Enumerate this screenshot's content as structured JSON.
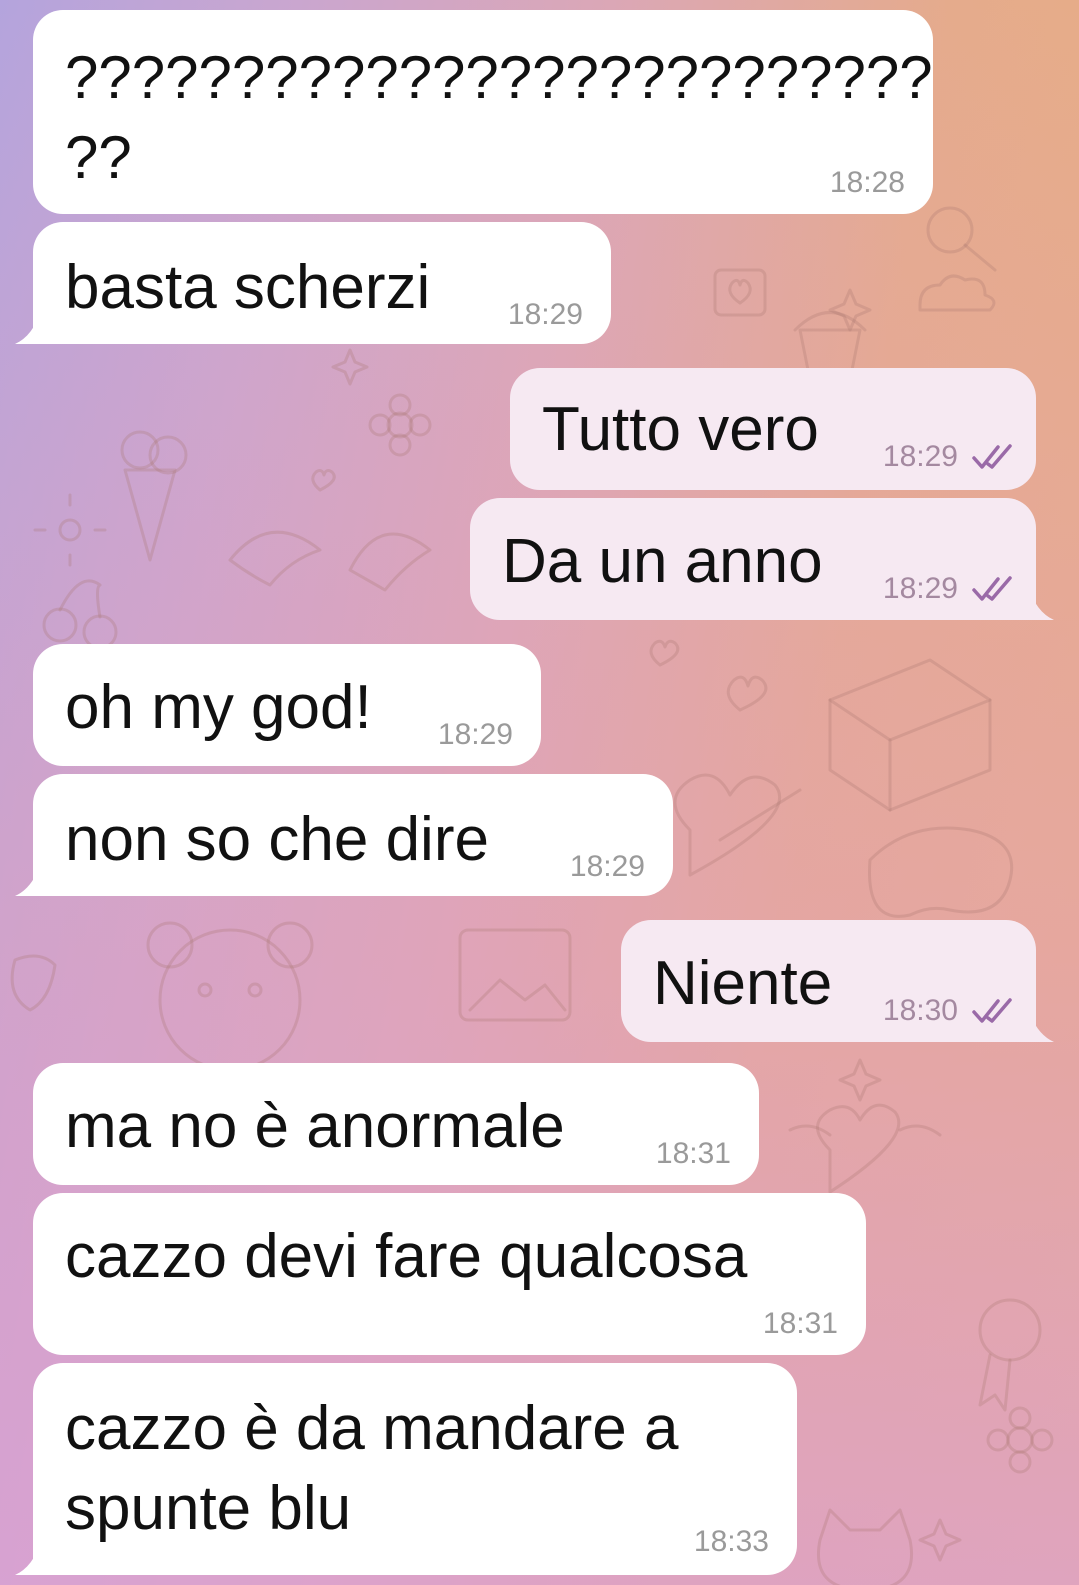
{
  "chat": {
    "background_colors": {
      "left": "#b4a4dd",
      "right": "#e8ae82"
    },
    "outgoing_bubble_color": "#f6e9f2",
    "incoming_bubble_color": "#ffffff",
    "check_color": "#9a6aa8",
    "messages": [
      {
        "direction": "in",
        "text": "??????????????????????????\n??",
        "time": "18:28"
      },
      {
        "direction": "in",
        "text": "basta scherzi",
        "time": "18:29"
      },
      {
        "direction": "out",
        "text": "Tutto vero",
        "time": "18:29",
        "status": "double-check-icon"
      },
      {
        "direction": "out",
        "text": "Da un anno",
        "time": "18:29",
        "status": "double-check-icon"
      },
      {
        "direction": "in",
        "text": "oh my god!",
        "time": "18:29"
      },
      {
        "direction": "in",
        "text": "non so che dire",
        "time": "18:29"
      },
      {
        "direction": "out",
        "text": "Niente",
        "time": "18:30",
        "status": "double-check-icon"
      },
      {
        "direction": "in",
        "text": "ma no è anormale",
        "time": "18:31"
      },
      {
        "direction": "in",
        "text": "cazzo devi fare qualcosa",
        "time": "18:31"
      },
      {
        "direction": "in",
        "text": "cazzo è da mandare a\nspunte blu",
        "time": "18:33"
      }
    ]
  }
}
